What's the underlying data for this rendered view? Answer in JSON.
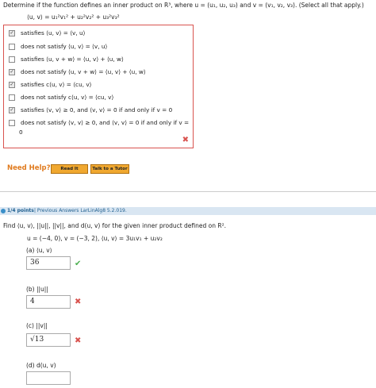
{
  "question1": {
    "prompt": "Determine if the function defines an inner product on R³, where u = (u₁, u₂, u₃) and v = (v₁, v₂, v₃). (Select all that apply.)",
    "formula": "⟨u, v⟩ = u₁²v₁² + u₂²v₂² + u₃²v₃²",
    "options": [
      {
        "label": "satisfies ⟨u, v⟩ = ⟨v, u⟩",
        "checked": true
      },
      {
        "label": "does not satisfy ⟨u, v⟩ = ⟨v, u⟩",
        "checked": false
      },
      {
        "label": "satisfies ⟨u, v + w⟩ = ⟨u, v⟩ + ⟨u, w⟩",
        "checked": false
      },
      {
        "label": "does not satisfy ⟨u, v + w⟩ = ⟨u, v⟩ + ⟨u, w⟩",
        "checked": true
      },
      {
        "label": "satisfies c⟨u, v⟩ = ⟨cu, v⟩",
        "checked": true
      },
      {
        "label": "does not satisfy c⟨u, v⟩ = ⟨cu, v⟩",
        "checked": false
      },
      {
        "label": "satisfies ⟨v, v⟩ ≥ 0, and ⟨v, v⟩ = 0 if and only if v = 0",
        "checked": true
      },
      {
        "label": "does not satisfy ⟨v, v⟩ ≥ 0, and ⟨v, v⟩ = 0 if and only if v =",
        "label2": "0",
        "checked": false
      }
    ],
    "result_icon": "close-icon"
  },
  "help": {
    "title": "Need Help?",
    "read_it": "Read It",
    "talk_tutor": "Talk to a Tutor"
  },
  "question2": {
    "points": "1/4 points",
    "meta": "|  Previous Answers   LarLinAlg8 5.2.019.",
    "prompt": "Find ⟨u, v⟩, ||u||, ||v||, and d(u, v) for the given inner product defined on R².",
    "given": "u = (−4, 0),    v = (−3, 2),    ⟨u, v⟩ = 3u₁v₁ + u₂v₂",
    "parts": [
      {
        "label": "(a)   ⟨u, v⟩",
        "answer": "36",
        "status": "correct"
      },
      {
        "label": "(b)   ||u||",
        "answer": "4",
        "status": "incorrect"
      },
      {
        "label": "(c)   ||v||",
        "answer": "√13",
        "status": "incorrect"
      },
      {
        "label": "(d)   d(u, v)",
        "answer": "",
        "status": "none"
      }
    ]
  },
  "colors": {
    "error": "#d9534f",
    "correct": "#4caf50",
    "help": "#e07b1f",
    "button": "#f0a830",
    "bar": "#d9e6f2"
  }
}
